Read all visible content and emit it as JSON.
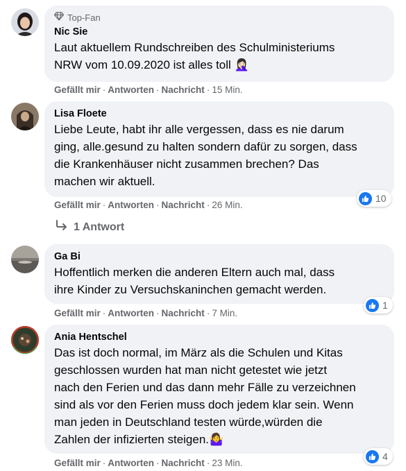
{
  "comments": [
    {
      "badge": "Top-Fan",
      "author": "Nic Sie",
      "lines": [
        "Laut aktuellem Rundschreiben des Schulministeriums",
        "NRW vom 10.09.2020 ist alles toll 🤦🏻‍♀️"
      ],
      "actions": {
        "like": "Gefällt mir",
        "reply": "Antworten",
        "message": "Nachricht",
        "time": "15 Min."
      }
    },
    {
      "author": "Lisa Floete",
      "lines": [
        "Liebe Leute, habt ihr alle vergessen, dass es nie darum",
        "ging, alle.gesund zu halten sondern dafür zu sorgen, dass",
        "die Krankenhäuser nicht zusammen brechen? Das",
        "machen wir aktuell."
      ],
      "actions": {
        "like": "Gefällt mir",
        "reply": "Antworten",
        "message": "Nachricht",
        "time": "26 Min."
      },
      "reaction_count": "10",
      "replies_label": "1 Antwort"
    },
    {
      "author": "Ga Bi",
      "lines": [
        "Hoffentlich merken die anderen Eltern auch mal, dass",
        "ihre Kinder zu Versuchskaninchen gemacht werden."
      ],
      "actions": {
        "like": "Gefällt mir",
        "reply": "Antworten",
        "message": "Nachricht",
        "time": "7 Min."
      },
      "reaction_count": "1"
    },
    {
      "author": "Ania Hentschel",
      "lines": [
        "Das ist doch normal, im März als die Schulen und Kitas",
        "geschlossen wurden hat man nicht getestet wie jetzt",
        "nach den Ferien und das dann mehr Fälle zu verzeichnen",
        "sind als vor den Ferien muss doch jedem klar sein. Wenn",
        "man jeden in Deutschland testen würde,würden die",
        "Zahlen der infizierten steigen.🤷‍♀️"
      ],
      "actions": {
        "like": "Gefällt mir",
        "reply": "Antworten",
        "message": "Nachricht",
        "time": "23 Min."
      },
      "reaction_count": "4"
    }
  ],
  "icons": {
    "badge": "diamond-icon",
    "reaction": "thumbs-up-icon",
    "reply": "reply-arrow-icon"
  },
  "colors": {
    "bubble": "#f0f2f5",
    "secondary_text": "#65676b",
    "like_blue": "#1877f2"
  }
}
